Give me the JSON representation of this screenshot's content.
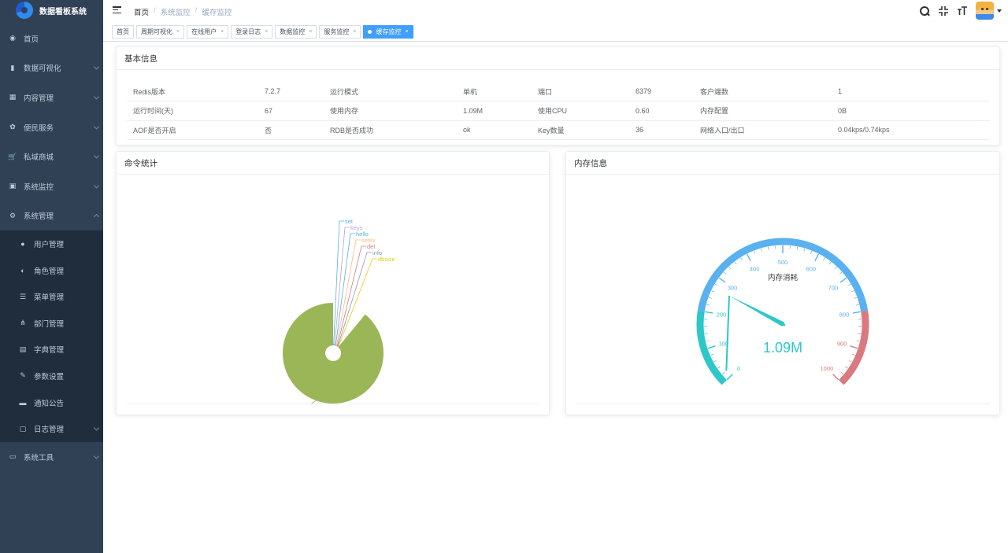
{
  "app": {
    "title": "数据看板系统"
  },
  "sidebar": {
    "items": [
      {
        "label": "首页",
        "icon": "dashboard-icon",
        "arrow": false
      },
      {
        "label": "数据可视化",
        "icon": "bar-chart-icon",
        "arrow": true
      },
      {
        "label": "内容管理",
        "icon": "table-icon",
        "arrow": true
      },
      {
        "label": "便民服务",
        "icon": "gear-flower-icon",
        "arrow": true
      },
      {
        "label": "私域商城",
        "icon": "cart-icon",
        "arrow": true
      },
      {
        "label": "系统监控",
        "icon": "monitor-icon",
        "arrow": true
      },
      {
        "label": "系统管理",
        "icon": "settings-icon",
        "arrow": "up"
      }
    ],
    "subitems": [
      {
        "label": "用户管理",
        "icon": "user-icon"
      },
      {
        "label": "角色管理",
        "icon": "users-icon"
      },
      {
        "label": "菜单管理",
        "icon": "tree-table-icon"
      },
      {
        "label": "部门管理",
        "icon": "org-tree-icon"
      },
      {
        "label": "字典管理",
        "icon": "dict-icon"
      },
      {
        "label": "参数设置",
        "icon": "edit-icon"
      },
      {
        "label": "通知公告",
        "icon": "message-icon"
      },
      {
        "label": "日志管理",
        "icon": "log-icon",
        "arrow": true
      }
    ],
    "tail": [
      {
        "label": "系统工具",
        "icon": "toolbox-icon",
        "arrow": true
      }
    ]
  },
  "breadcrumb": {
    "home": "首页",
    "level1": "系统监控",
    "level2": "缓存监控",
    "sep": "/"
  },
  "tags": [
    {
      "label": "首页",
      "closable": false,
      "active": false
    },
    {
      "label": "周期可视化",
      "closable": true,
      "active": false
    },
    {
      "label": "在线用户",
      "closable": true,
      "active": false
    },
    {
      "label": "登录日志",
      "closable": true,
      "active": false
    },
    {
      "label": "数据监控",
      "closable": true,
      "active": false
    },
    {
      "label": "服务监控",
      "closable": true,
      "active": false
    },
    {
      "label": "缓存监控",
      "closable": true,
      "active": true
    }
  ],
  "basic_info": {
    "title": "基本信息",
    "rows": [
      [
        "Redis版本",
        "7.2.7",
        "运行模式",
        "单机",
        "端口",
        "6379",
        "客户端数",
        "1"
      ],
      [
        "运行时间(天)",
        "67",
        "使用内存",
        "1.09M",
        "使用CPU",
        "0.60",
        "内存配置",
        "0B"
      ],
      [
        "AOF是否开启",
        "否",
        "RDB是否成功",
        "ok",
        "Key数量",
        "36",
        "网络入口/出口",
        "0.04kps/0.74kps"
      ]
    ]
  },
  "command_stats": {
    "title": "命令统计"
  },
  "memory_info": {
    "title": "内存信息"
  },
  "chart_data": [
    {
      "type": "pie",
      "title": "",
      "series": [
        {
          "name": "get",
          "value": 89.0,
          "color": "#9bb657"
        },
        {
          "name": "set",
          "value": 2.0,
          "color": "#5ab1ef"
        },
        {
          "name": "keys",
          "value": 1.8,
          "color": "#b6a2de"
        },
        {
          "name": "hello",
          "value": 1.8,
          "color": "#4eb5d6"
        },
        {
          "name": "setex",
          "value": 1.6,
          "color": "#ffb980"
        },
        {
          "name": "del",
          "value": 1.4,
          "color": "#d87a80"
        },
        {
          "name": "info",
          "value": 1.2,
          "color": "#8d98b3"
        },
        {
          "name": "dbsize",
          "value": 1.2,
          "color": "#e5cf0d"
        }
      ]
    },
    {
      "type": "gauge",
      "name": "内存消耗",
      "value": 1.09,
      "value_label": "1.09M",
      "min": 0,
      "max": 1000,
      "ticks": [
        "0",
        "100",
        "200",
        "300",
        "400",
        "500",
        "600",
        "700",
        "800",
        "900",
        "1000"
      ],
      "colors": {
        "low": "#2ec7c9",
        "mid": "#5ab1ef",
        "high": "#d87a80",
        "pointer": "#2ec7c9"
      }
    }
  ]
}
